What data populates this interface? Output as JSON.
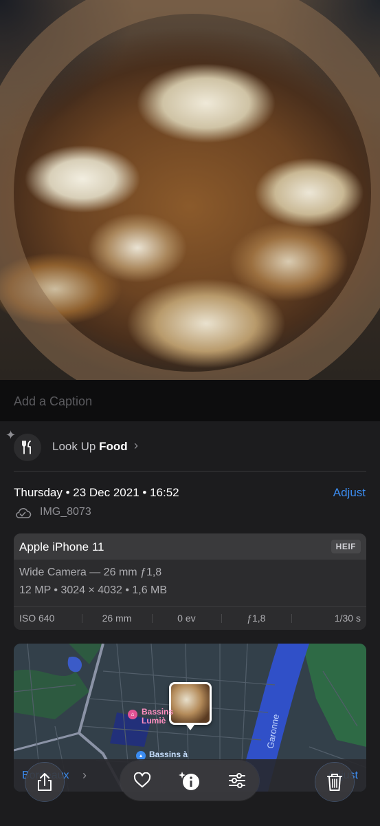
{
  "caption": {
    "placeholder": "Add a Caption"
  },
  "lookup": {
    "prefix": "Look Up",
    "subject": "Food"
  },
  "meta": {
    "date": "Thursday • 23 Dec 2021 • 16:52",
    "adjust_label": "Adjust",
    "filename": "IMG_8073"
  },
  "camera": {
    "device": "Apple iPhone 11",
    "format": "HEIF",
    "lens": "Wide Camera — 26 mm ƒ1,8",
    "specs": "12 MP  •  3024 × 4032  •  1,6 MB",
    "exif": [
      "ISO 640",
      "26 mm",
      "0 ev",
      "ƒ1,8",
      "1/30 s"
    ]
  },
  "map": {
    "place_label": "Bordeaux",
    "action_label": "Adjust",
    "poi_1": "Bassins de Lumières",
    "poi_1_line1": "Bassins",
    "poi_1_line2": "Lumiè",
    "poi_2": "Bassins à",
    "river": "Garonne"
  },
  "toolbar": {
    "share": "share-icon",
    "favorite": "heart-icon",
    "info": "info-sparkle-icon",
    "adjust": "sliders-icon",
    "delete": "trash-icon"
  },
  "colors": {
    "accent": "#3b8cf0",
    "background": "#1c1c1e",
    "card": "#2c2c2e"
  }
}
